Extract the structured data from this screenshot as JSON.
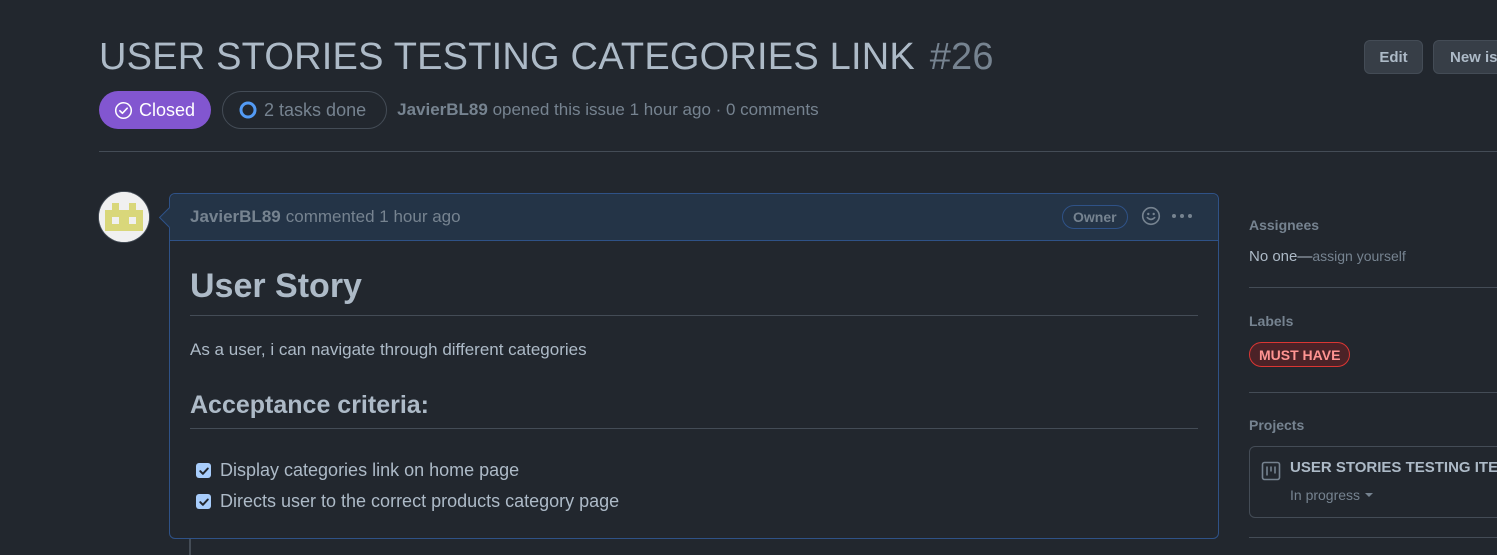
{
  "issue": {
    "title": "USER STORIES TESTING CATEGORIES LINK",
    "number": "#26",
    "state": "Closed",
    "tasks": "2 tasks done",
    "author": "JavierBL89",
    "meta_suffix": " opened this issue 1 hour ago · 0 comments"
  },
  "header_actions": {
    "edit_label": "Edit",
    "new_issue_label": "New issue"
  },
  "comment": {
    "author": "JavierBL89",
    "when": "commented 1 hour ago",
    "owner_badge": "Owner",
    "body": {
      "heading": "User Story",
      "paragraph": "As a user, i can navigate through different categories",
      "subheading": "Acceptance criteria:",
      "tasks": [
        {
          "label": "Display categories link on home page",
          "checked": true
        },
        {
          "label": "Directs user to the correct products category page",
          "checked": true
        }
      ]
    }
  },
  "sidebar": {
    "assignees": {
      "heading": "Assignees",
      "value": "No one—",
      "link": "assign yourself"
    },
    "labels": {
      "heading": "Labels",
      "items": [
        {
          "name": "MUST HAVE",
          "color": "#da3633"
        }
      ]
    },
    "projects": {
      "heading": "Projects",
      "items": [
        {
          "name": "USER STORIES TESTING ITERATION",
          "status": "In progress"
        }
      ]
    }
  },
  "colors": {
    "background": "#22272e",
    "closed_badge": "#8256d0",
    "comment_header": "#243447",
    "accent_border": "#2f5287",
    "checkbox": "#a8cdfc"
  },
  "icons": [
    "check-circle-icon",
    "progress-circle-icon",
    "smiley-icon",
    "kebab-icon",
    "project-board-icon",
    "caret-down-icon",
    "checkbox-icon"
  ]
}
